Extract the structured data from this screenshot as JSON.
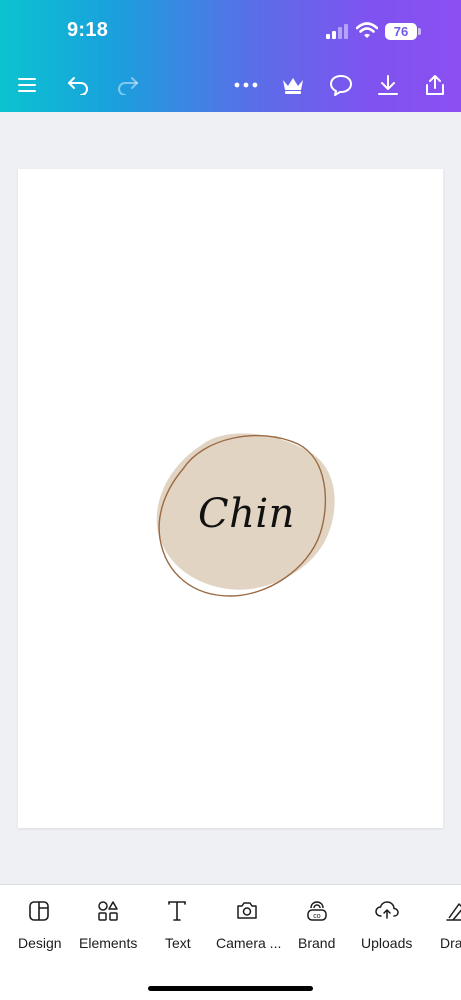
{
  "status_bar": {
    "time": "9:18",
    "battery_level": "76"
  },
  "toolbar": {
    "icons": [
      "menu-icon",
      "undo-icon",
      "redo-icon",
      "more-icon",
      "crown-icon",
      "comment-icon",
      "download-icon",
      "share-icon"
    ]
  },
  "canvas": {
    "logo_text": "Chin",
    "blob_color": "#e2d4c3",
    "ring_color": "#9a6a43"
  },
  "bottom_nav": {
    "items": [
      {
        "label": "Design",
        "icon": "design-icon"
      },
      {
        "label": "Elements",
        "icon": "elements-icon"
      },
      {
        "label": "Text",
        "icon": "text-icon"
      },
      {
        "label": "Camera ...",
        "icon": "camera-icon"
      },
      {
        "label": "Brand",
        "icon": "brand-icon"
      },
      {
        "label": "Uploads",
        "icon": "uploads-icon"
      },
      {
        "label": "Dra",
        "icon": "draw-icon"
      }
    ]
  },
  "colors": {
    "gradient_start": "#0bc3cf",
    "gradient_end": "#8b4ff2",
    "workspace": "#eff0f4"
  }
}
